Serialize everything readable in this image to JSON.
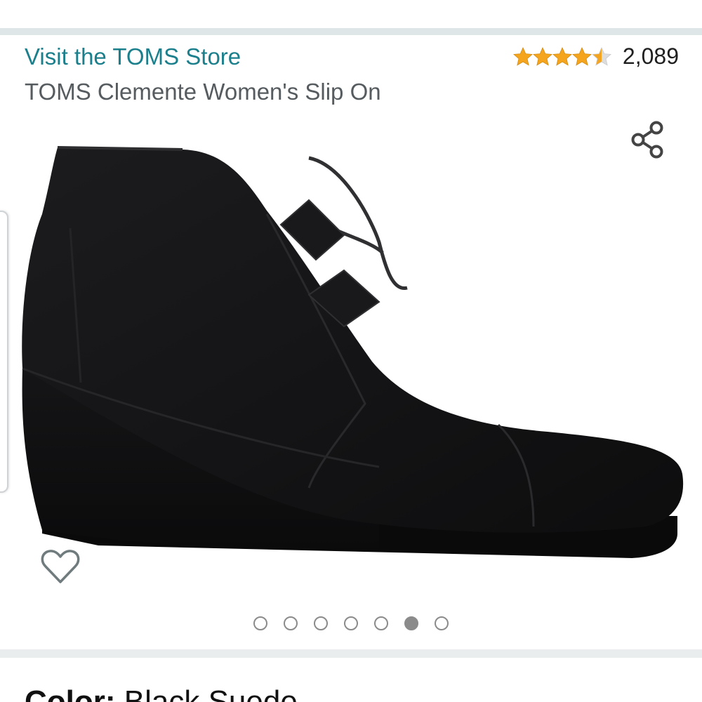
{
  "header": {
    "store_link": "Visit the TOMS Store",
    "product_title": "TOMS Clemente Women's Slip On"
  },
  "rating": {
    "stars": 4.5,
    "count": "2,089",
    "star_color": "#f4a41d",
    "star_empty_color": "#dddddd"
  },
  "icons": {
    "share": "share-icon",
    "wishlist": "heart-outline-icon"
  },
  "carousel": {
    "total_images": 7,
    "active_index": 5
  },
  "color_selector": {
    "label": "Color:",
    "value": "Black Suede"
  },
  "colors": {
    "link": "#1b7f8c",
    "divider": "#dfe6e7"
  }
}
